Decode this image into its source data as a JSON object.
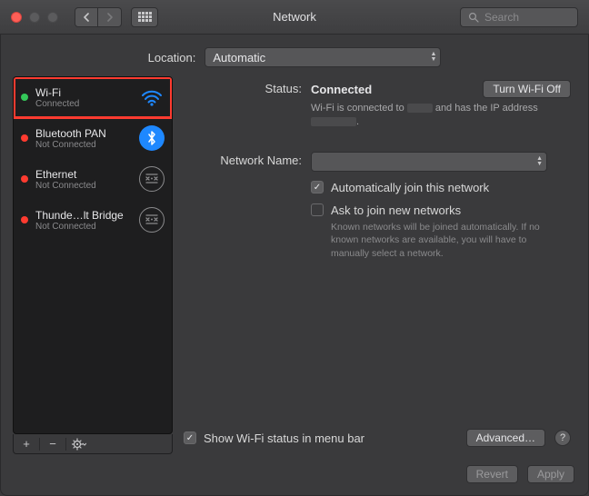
{
  "title": "Network",
  "search": {
    "placeholder": "Search"
  },
  "location": {
    "label": "Location:",
    "value": "Automatic"
  },
  "sidebar": {
    "items": [
      {
        "name": "Wi-Fi",
        "status": "Connected",
        "dot": "green",
        "icon": "wifi",
        "selected": true
      },
      {
        "name": "Bluetooth PAN",
        "status": "Not Connected",
        "dot": "red",
        "icon": "bluetooth"
      },
      {
        "name": "Ethernet",
        "status": "Not Connected",
        "dot": "red",
        "icon": "ethernet"
      },
      {
        "name": "Thunde…lt Bridge",
        "status": "Not Connected",
        "dot": "red",
        "icon": "thunderbolt"
      }
    ]
  },
  "detail": {
    "status_label": "Status:",
    "status_value": "Connected",
    "toggle_button": "Turn Wi-Fi Off",
    "status_sub_prefix": "Wi-Fi is connected to ",
    "status_sub_mid": " and has the IP address ",
    "status_sub_suffix": ".",
    "network_name_label": "Network Name:",
    "network_name_value": "",
    "auto_join": "Automatically join this network",
    "ask_join": "Ask to join new networks",
    "ask_help": "Known networks will be joined automatically. If no known networks are available, you will have to manually select a network.",
    "show_status": "Show Wi-Fi status in menu bar",
    "advanced": "Advanced…"
  },
  "footer": {
    "revert": "Revert",
    "apply": "Apply"
  }
}
